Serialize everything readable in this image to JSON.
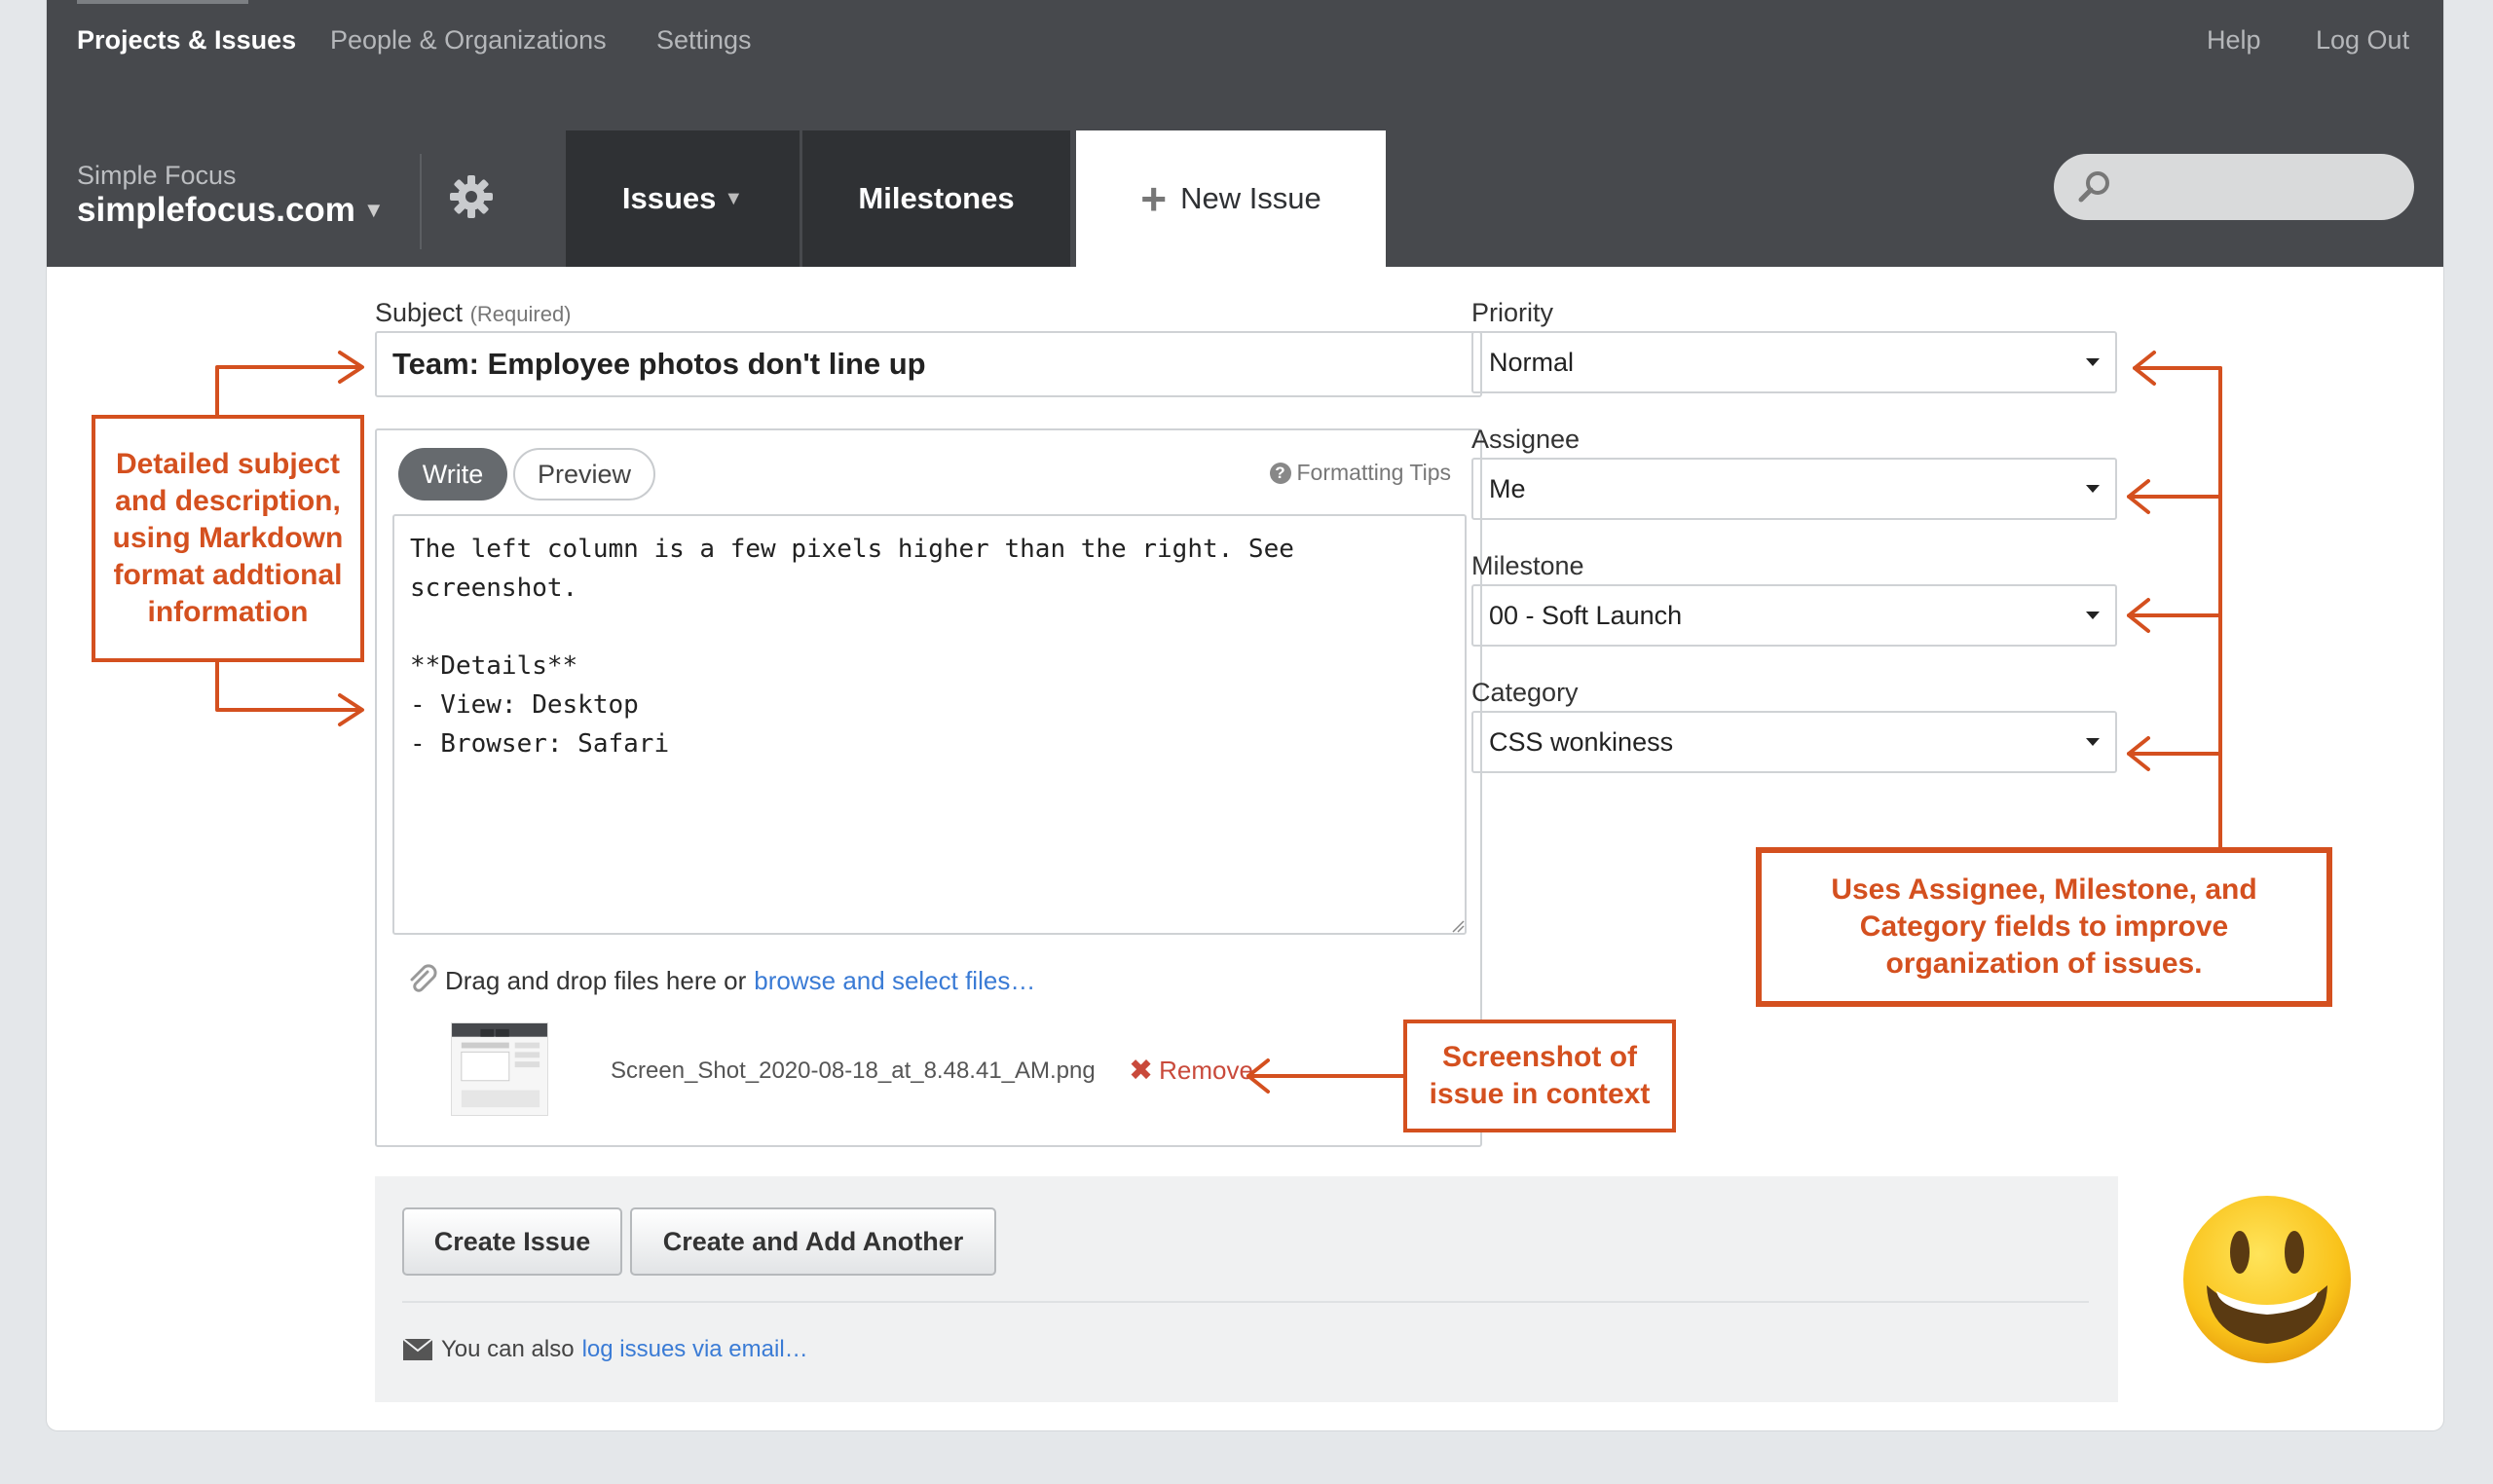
{
  "topnav": {
    "projects": "Projects & Issues",
    "people": "People & Organizations",
    "settings": "Settings",
    "help": "Help",
    "logout": "Log Out"
  },
  "workspace": {
    "company": "Simple Focus",
    "domain": "simplefocus.com"
  },
  "tabs": {
    "issues": "Issues",
    "milestones": "Milestones",
    "new_issue": "New Issue"
  },
  "search": {
    "placeholder": ""
  },
  "form": {
    "subject_label": "Subject",
    "subject_required": "(Required)",
    "subject_value": "Team: Employee photos don't line up",
    "write_tab": "Write",
    "preview_tab": "Preview",
    "formatting_tips": "Formatting Tips",
    "description": "The left column is a few pixels higher than the right. See\nscreenshot.\n\n**Details**\n- View: Desktop\n- Browser: Safari",
    "dropzone_text": "Drag and drop files here or",
    "dropzone_link": "browse and select files…",
    "attachment_name": "Screen_Shot_2020-08-18_at_8.48.41_AM.png",
    "remove_label": "Remove",
    "priority_label": "Priority",
    "priority_value": "Normal",
    "assignee_label": "Assignee",
    "assignee_value": "Me",
    "milestone_label": "Milestone",
    "milestone_value": "00 - Soft Launch",
    "category_label": "Category",
    "category_value": "CSS wonkiness"
  },
  "footer": {
    "create_button": "Create Issue",
    "create_another_button": "Create and Add Another",
    "note_text": "You can also",
    "note_link": "log issues via email…"
  },
  "annotations": {
    "subject_description": "Detailed subject and description, using Markdown format addtional information",
    "fields": "Uses Assignee, Milestone, and Category fields to improve organization of issues.",
    "screenshot": "Screenshot of issue in context"
  },
  "colors": {
    "topbar": "#47494d",
    "tab_dark": "#2f3134",
    "accent_link": "#3a7bd5",
    "callout": "#d4501f"
  }
}
